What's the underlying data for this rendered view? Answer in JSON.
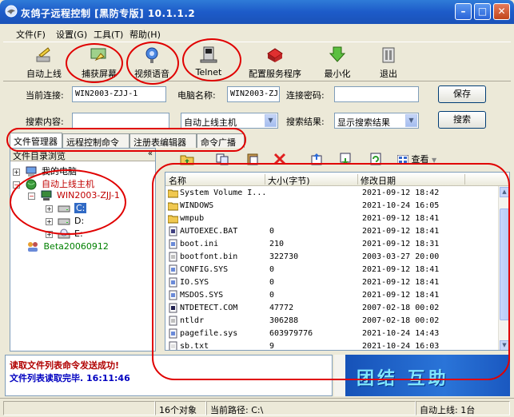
{
  "window": {
    "title": "灰鸽子远程控制  [黑防专版]    10.1.1.2",
    "minimize": "–",
    "maximize": "□",
    "close": "✕"
  },
  "menu": [
    "文件(F)",
    "设置(G)",
    "工具(T)",
    "帮助(H)"
  ],
  "toolbar": [
    {
      "label": "自动上线",
      "icon": "auto-online-icon"
    },
    {
      "label": "捕获屏幕",
      "icon": "capture-screen-icon"
    },
    {
      "label": "视频语音",
      "icon": "video-voice-icon"
    },
    {
      "label": "Telnet",
      "icon": "telnet-icon"
    },
    {
      "label": "配置服务程序",
      "icon": "configure-service-icon"
    },
    {
      "label": "最小化",
      "icon": "minimize-icon"
    },
    {
      "label": "退出",
      "icon": "exit-icon"
    }
  ],
  "connection": {
    "current_label": "当前连接:",
    "current_value": "WIN2003-ZJJ-1",
    "name_label": "电脑名称:",
    "name_value": "WIN2003-ZJ.",
    "password_label": "连接密码:",
    "password_value": "",
    "save": "保存"
  },
  "search": {
    "content_label": "搜索内容:",
    "content_value": "",
    "scope_value": "自动上线主机",
    "result_label": "搜索结果:",
    "result_value": "显示搜索结果",
    "button": "搜索"
  },
  "tabs": [
    "文件管理器",
    "远程控制命令",
    "注册表编辑器",
    "命令广播"
  ],
  "tree": {
    "header": "文件目录浏览",
    "collapse": "«",
    "nodes": [
      {
        "label": "我的电脑"
      },
      {
        "label": "自动上线主机"
      },
      {
        "label": "WIN2003-ZJJ-1"
      },
      {
        "label": "C:"
      },
      {
        "label": "D:"
      },
      {
        "label": "E:"
      },
      {
        "label": "Beta20060912"
      }
    ]
  },
  "files": {
    "view_label": "查看",
    "columns": [
      "名称",
      "大小(字节)",
      "修改日期"
    ],
    "rows": [
      {
        "name": "System Volume I...",
        "size": "",
        "date": "2021-09-12 18:42",
        "type": "folder"
      },
      {
        "name": "WINDOWS",
        "size": "",
        "date": "2021-10-24 16:05",
        "type": "folder"
      },
      {
        "name": "wmpub",
        "size": "",
        "date": "2021-09-12 18:41",
        "type": "folder"
      },
      {
        "name": "AUTOEXEC.BAT",
        "size": "0",
        "date": "2021-09-12 18:41",
        "type": "bat"
      },
      {
        "name": "boot.ini",
        "size": "210",
        "date": "2021-09-12 18:31",
        "type": "ini"
      },
      {
        "name": "bootfont.bin",
        "size": "322730",
        "date": "2003-03-27 20:00",
        "type": "file"
      },
      {
        "name": "CONFIG.SYS",
        "size": "0",
        "date": "2021-09-12 18:41",
        "type": "sys"
      },
      {
        "name": "IO.SYS",
        "size": "0",
        "date": "2021-09-12 18:41",
        "type": "sys"
      },
      {
        "name": "MSDOS.SYS",
        "size": "0",
        "date": "2021-09-12 18:41",
        "type": "sys"
      },
      {
        "name": "NTDETECT.COM",
        "size": "47772",
        "date": "2007-02-18 00:02",
        "type": "com"
      },
      {
        "name": "ntldr",
        "size": "306288",
        "date": "2007-02-18 00:02",
        "type": "file"
      },
      {
        "name": "pagefile.sys",
        "size": "603979776",
        "date": "2021-10-24 14:43",
        "type": "sys"
      },
      {
        "name": "sb.txt",
        "size": "9",
        "date": "2021-10-24 16:03",
        "type": "txt"
      }
    ]
  },
  "log": {
    "line1": "读取文件列表命令发送成功!",
    "line2": "文件列表读取完毕.  16:11:46"
  },
  "banner": "团结 互助",
  "status": {
    "objects": "16个对象",
    "path": "当前路径: C:\\",
    "online": "自动上线: 1台"
  }
}
